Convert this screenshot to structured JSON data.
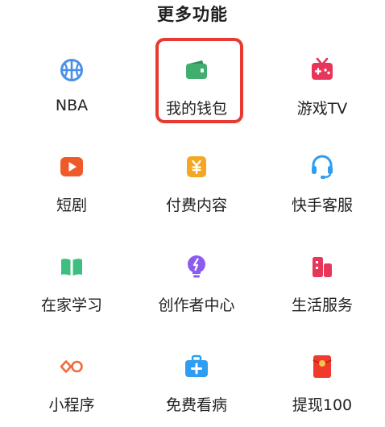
{
  "section": {
    "title": "更多功能"
  },
  "features": [
    {
      "label": "NBA",
      "icon": "basketball-icon",
      "color": "#4a90e8"
    },
    {
      "label": "我的钱包",
      "icon": "wallet-icon",
      "color": "#3fae6f"
    },
    {
      "label": "游戏TV",
      "icon": "game-tv-icon",
      "color": "#e8355a"
    },
    {
      "label": "短剧",
      "icon": "play-icon",
      "color": "#f05a28"
    },
    {
      "label": "付费内容",
      "icon": "yuan-icon",
      "color": "#f5a623"
    },
    {
      "label": "快手客服",
      "icon": "headset-icon",
      "color": "#2f9df2"
    },
    {
      "label": "在家学习",
      "icon": "book-icon",
      "color": "#3fbf7f"
    },
    {
      "label": "创作者中心",
      "icon": "lightbulb-icon",
      "color": "#8a5cf0"
    },
    {
      "label": "生活服务",
      "icon": "buildings-icon",
      "color": "#e8355a"
    },
    {
      "label": "小程序",
      "icon": "mini-program-icon",
      "color": "#f06a3a"
    },
    {
      "label": "免费看病",
      "icon": "medical-kit-icon",
      "color": "#2f9df2"
    },
    {
      "label": "提现100",
      "icon": "red-envelope-icon",
      "color": "#f03a2e"
    }
  ],
  "highlight": {
    "target": "我的钱包",
    "color": "#e83a30"
  }
}
